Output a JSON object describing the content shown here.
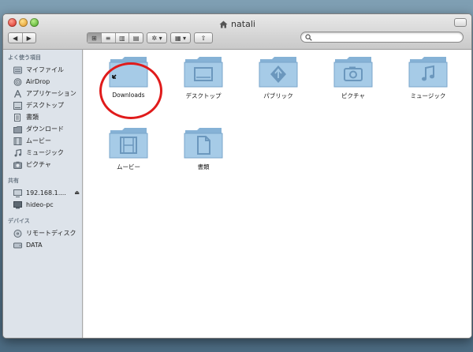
{
  "window": {
    "title": "natali"
  },
  "toolbar": {
    "back": "◀",
    "forward": "▶",
    "view_icon": "⊞",
    "view_list": "≡",
    "view_columns": "▥",
    "view_coverflow": "▤",
    "action": "✲ ▾",
    "arrange": "▦ ▾",
    "share": "⇧"
  },
  "search": {
    "placeholder": "",
    "value": ""
  },
  "sidebar": {
    "favorites_header": "よく使う項目",
    "favorites": [
      {
        "label": "マイファイル",
        "icon": "all-my-files-icon"
      },
      {
        "label": "AirDrop",
        "icon": "airdrop-icon"
      },
      {
        "label": "アプリケーション",
        "icon": "applications-icon"
      },
      {
        "label": "デスクトップ",
        "icon": "desktop-icon"
      },
      {
        "label": "書類",
        "icon": "documents-icon"
      },
      {
        "label": "ダウンロード",
        "icon": "downloads-icon"
      },
      {
        "label": "ムービー",
        "icon": "movies-icon"
      },
      {
        "label": "ミュージック",
        "icon": "music-icon"
      },
      {
        "label": "ピクチャ",
        "icon": "pictures-icon"
      }
    ],
    "shared_header": "共有",
    "shared": [
      {
        "label": "192.168.1....",
        "icon": "server-icon",
        "eject": "⏏"
      },
      {
        "label": "hideo-pc",
        "icon": "pc-icon"
      }
    ],
    "devices_header": "デバイス",
    "devices": [
      {
        "label": "リモートディスク",
        "icon": "remote-disc-icon"
      },
      {
        "label": "DATA",
        "icon": "drive-icon"
      }
    ]
  },
  "content": {
    "items": [
      {
        "label": "Downloads",
        "icon": "downloads-alias-folder-icon"
      },
      {
        "label": "デスクトップ",
        "icon": "desktop-folder-icon"
      },
      {
        "label": "パブリック",
        "icon": "public-folder-icon"
      },
      {
        "label": "ピクチャ",
        "icon": "pictures-folder-icon"
      },
      {
        "label": "ミュージック",
        "icon": "music-folder-icon"
      },
      {
        "label": "ムービー",
        "icon": "movies-folder-icon"
      },
      {
        "label": "書類",
        "icon": "documents-folder-icon"
      }
    ]
  },
  "colors": {
    "folder": "#9cc3e0",
    "folder_dark": "#6f9fc6",
    "annotation": "#e01b1b",
    "sidebar_bg": "#dde3ea"
  }
}
